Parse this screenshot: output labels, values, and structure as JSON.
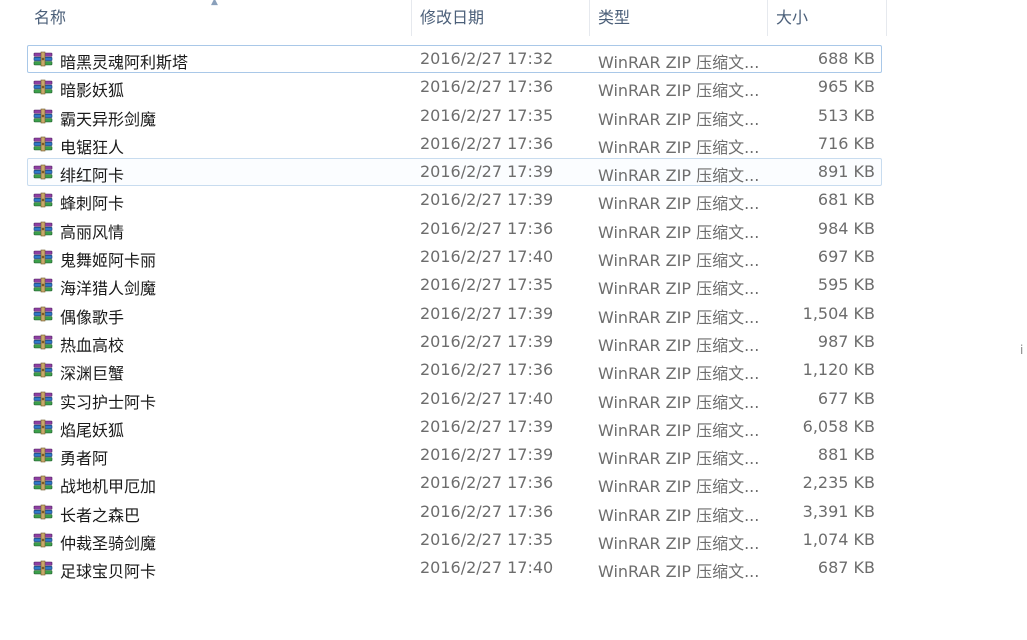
{
  "columns": {
    "name": "名称",
    "modified": "修改日期",
    "type": "类型",
    "size": "大小"
  },
  "sort_indicator": "ascending",
  "files": [
    {
      "name": "暗黑灵魂阿利斯塔",
      "modified": "2016/2/27 17:32",
      "type": "WinRAR ZIP 压缩文...",
      "size": "688 KB",
      "icon": "winrar-archive-icon"
    },
    {
      "name": "暗影妖狐",
      "modified": "2016/2/27 17:36",
      "type": "WinRAR ZIP 压缩文...",
      "size": "965 KB",
      "icon": "winrar-archive-icon"
    },
    {
      "name": "霸天异形剑魔",
      "modified": "2016/2/27 17:35",
      "type": "WinRAR ZIP 压缩文...",
      "size": "513 KB",
      "icon": "winrar-archive-icon"
    },
    {
      "name": "电锯狂人",
      "modified": "2016/2/27 17:36",
      "type": "WinRAR ZIP 压缩文...",
      "size": "716 KB",
      "icon": "winrar-archive-icon"
    },
    {
      "name": "绯红阿卡",
      "modified": "2016/2/27 17:39",
      "type": "WinRAR ZIP 压缩文...",
      "size": "891 KB",
      "icon": "winrar-archive-icon"
    },
    {
      "name": "蜂刺阿卡",
      "modified": "2016/2/27 17:39",
      "type": "WinRAR ZIP 压缩文...",
      "size": "681 KB",
      "icon": "winrar-archive-icon"
    },
    {
      "name": "高丽风情",
      "modified": "2016/2/27 17:36",
      "type": "WinRAR ZIP 压缩文...",
      "size": "984 KB",
      "icon": "winrar-archive-icon"
    },
    {
      "name": "鬼舞姬阿卡丽",
      "modified": "2016/2/27 17:40",
      "type": "WinRAR ZIP 压缩文...",
      "size": "697 KB",
      "icon": "winrar-archive-icon"
    },
    {
      "name": "海洋猎人剑魔",
      "modified": "2016/2/27 17:35",
      "type": "WinRAR ZIP 压缩文...",
      "size": "595 KB",
      "icon": "winrar-archive-icon"
    },
    {
      "name": "偶像歌手",
      "modified": "2016/2/27 17:39",
      "type": "WinRAR ZIP 压缩文...",
      "size": "1,504 KB",
      "icon": "winrar-archive-icon"
    },
    {
      "name": "热血高校",
      "modified": "2016/2/27 17:39",
      "type": "WinRAR ZIP 压缩文...",
      "size": "987 KB",
      "icon": "winrar-archive-icon"
    },
    {
      "name": "深渊巨蟹",
      "modified": "2016/2/27 17:36",
      "type": "WinRAR ZIP 压缩文...",
      "size": "1,120 KB",
      "icon": "winrar-archive-icon"
    },
    {
      "name": "实习护士阿卡",
      "modified": "2016/2/27 17:40",
      "type": "WinRAR ZIP 压缩文...",
      "size": "677 KB",
      "icon": "winrar-archive-icon"
    },
    {
      "name": "焰尾妖狐",
      "modified": "2016/2/27 17:39",
      "type": "WinRAR ZIP 压缩文...",
      "size": "6,058 KB",
      "icon": "winrar-archive-icon"
    },
    {
      "name": "勇者阿",
      "modified": "2016/2/27 17:39",
      "type": "WinRAR ZIP 压缩文...",
      "size": "881 KB",
      "icon": "winrar-archive-icon"
    },
    {
      "name": "战地机甲厄加",
      "modified": "2016/2/27 17:36",
      "type": "WinRAR ZIP 压缩文...",
      "size": "2,235 KB",
      "icon": "winrar-archive-icon"
    },
    {
      "name": "长者之森巴",
      "modified": "2016/2/27 17:36",
      "type": "WinRAR ZIP 压缩文...",
      "size": "3,391 KB",
      "icon": "winrar-archive-icon"
    },
    {
      "name": "仲裁圣骑剑魔",
      "modified": "2016/2/27 17:35",
      "type": "WinRAR ZIP 压缩文...",
      "size": "1,074 KB",
      "icon": "winrar-archive-icon"
    },
    {
      "name": "足球宝贝阿卡",
      "modified": "2016/2/27 17:40",
      "type": "WinRAR ZIP 压缩文...",
      "size": "687 KB",
      "icon": "winrar-archive-icon"
    }
  ],
  "focused_index": 0,
  "hovered_index": 4,
  "edge_glyph": "i"
}
